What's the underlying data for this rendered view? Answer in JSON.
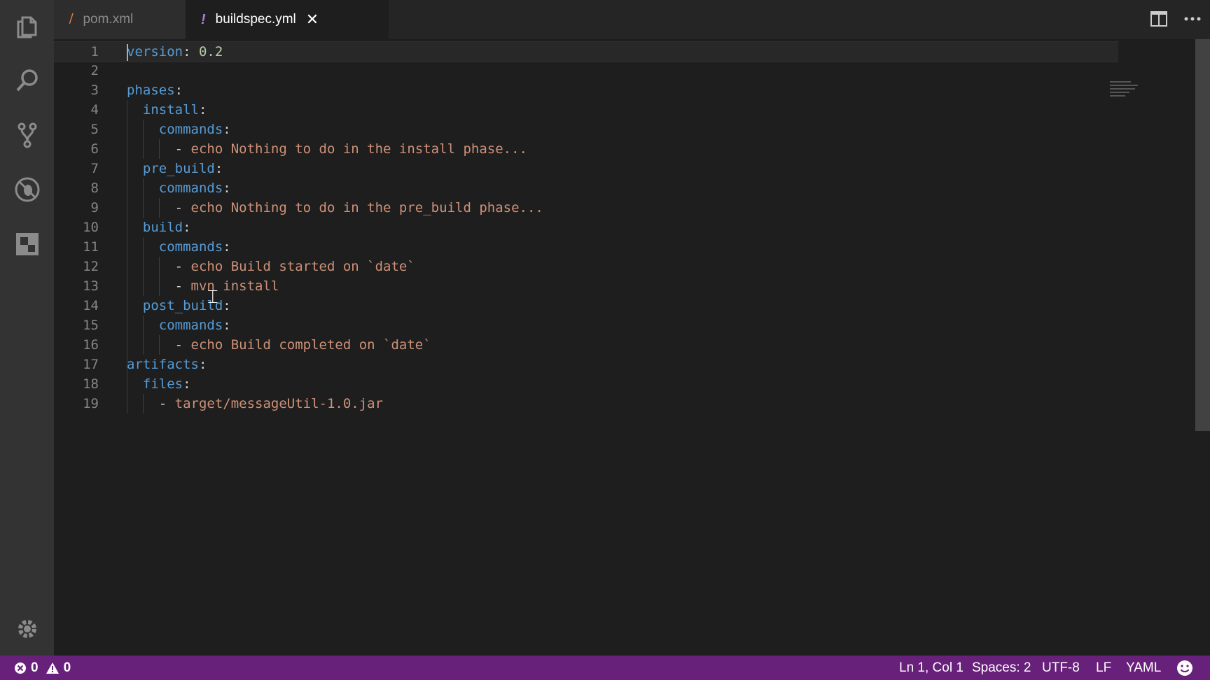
{
  "tabs": [
    {
      "icon": "rss-icon",
      "icon_glyph": "ʃʃ",
      "label": "pom.xml"
    },
    {
      "icon": "exclamation-icon",
      "icon_glyph": "!",
      "label": "buildspec.yml",
      "close": "✕"
    }
  ],
  "activity_bar": [
    "explorer-icon",
    "search-icon",
    "source-control-icon",
    "debug-icon",
    "extensions-icon",
    "settings-gear-icon"
  ],
  "editor": {
    "lines": [
      {
        "n": "1",
        "tokens": [
          {
            "t": "version",
            "c": "k"
          },
          {
            "t": ": ",
            "c": "p"
          },
          {
            "t": "0.2",
            "c": "n"
          }
        ]
      },
      {
        "n": "2",
        "tokens": []
      },
      {
        "n": "3",
        "tokens": [
          {
            "t": "phases",
            "c": "k"
          },
          {
            "t": ":",
            "c": "p"
          }
        ]
      },
      {
        "n": "4",
        "tokens": [
          {
            "t": "  install",
            "c": "k"
          },
          {
            "t": ":",
            "c": "p"
          }
        ]
      },
      {
        "n": "5",
        "tokens": [
          {
            "t": "    commands",
            "c": "k"
          },
          {
            "t": ":",
            "c": "p"
          }
        ]
      },
      {
        "n": "6",
        "tokens": [
          {
            "t": "      - ",
            "c": "p"
          },
          {
            "t": "echo Nothing to do in the install phase...",
            "c": "s"
          }
        ]
      },
      {
        "n": "7",
        "tokens": [
          {
            "t": "  pre_build",
            "c": "k"
          },
          {
            "t": ":",
            "c": "p"
          }
        ]
      },
      {
        "n": "8",
        "tokens": [
          {
            "t": "    commands",
            "c": "k"
          },
          {
            "t": ":",
            "c": "p"
          }
        ]
      },
      {
        "n": "9",
        "tokens": [
          {
            "t": "      - ",
            "c": "p"
          },
          {
            "t": "echo Nothing to do in the pre_build phase...",
            "c": "s"
          }
        ]
      },
      {
        "n": "10",
        "tokens": [
          {
            "t": "  build",
            "c": "k"
          },
          {
            "t": ":",
            "c": "p"
          }
        ]
      },
      {
        "n": "11",
        "tokens": [
          {
            "t": "    commands",
            "c": "k"
          },
          {
            "t": ":",
            "c": "p"
          }
        ]
      },
      {
        "n": "12",
        "tokens": [
          {
            "t": "      - ",
            "c": "p"
          },
          {
            "t": "echo Build started on `date`",
            "c": "s"
          }
        ]
      },
      {
        "n": "13",
        "tokens": [
          {
            "t": "      - ",
            "c": "p"
          },
          {
            "t": "mvn install",
            "c": "s"
          }
        ]
      },
      {
        "n": "14",
        "tokens": [
          {
            "t": "  post_build",
            "c": "k"
          },
          {
            "t": ":",
            "c": "p"
          }
        ]
      },
      {
        "n": "15",
        "tokens": [
          {
            "t": "    commands",
            "c": "k"
          },
          {
            "t": ":",
            "c": "p"
          }
        ]
      },
      {
        "n": "16",
        "tokens": [
          {
            "t": "      - ",
            "c": "p"
          },
          {
            "t": "echo Build completed on `date`",
            "c": "s"
          }
        ]
      },
      {
        "n": "17",
        "tokens": [
          {
            "t": "artifacts",
            "c": "k"
          },
          {
            "t": ":",
            "c": "p"
          }
        ]
      },
      {
        "n": "18",
        "tokens": [
          {
            "t": "  files",
            "c": "k"
          },
          {
            "t": ":",
            "c": "p"
          }
        ]
      },
      {
        "n": "19",
        "tokens": [
          {
            "t": "    - ",
            "c": "p"
          },
          {
            "t": "target/messageUtil-1.0.jar",
            "c": "s"
          }
        ]
      }
    ]
  },
  "statusbar": {
    "errors": "0",
    "warnings": "0",
    "position": "Ln 1, Col 1",
    "spaces": "Spaces: 2",
    "encoding": "UTF-8",
    "eol": "LF",
    "language": "YAML"
  },
  "colors": {
    "statusbar": "#68217a",
    "keyword": "#569cd6",
    "string": "#ce9178",
    "number": "#b5cea8"
  }
}
